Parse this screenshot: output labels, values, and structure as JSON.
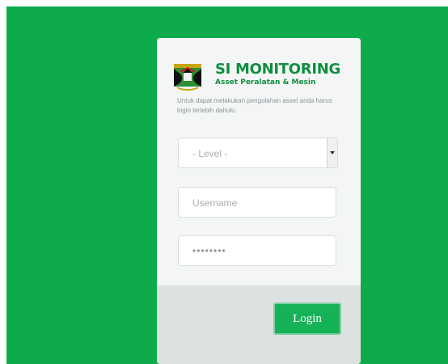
{
  "app": {
    "title": "SI MONITORING",
    "subtitle": "Asset Peralatan & Mesin",
    "intro_text": "Untuk dapat melakukan pengolahan asset anda harus login terlebih dahulu."
  },
  "form": {
    "level_select": {
      "selected_value": "- Level -",
      "options": [
        "- Level -"
      ]
    },
    "username": {
      "value": "",
      "placeholder": "Username"
    },
    "password": {
      "value": "••••••••",
      "placeholder": ""
    },
    "login_label": "Login"
  },
  "colors": {
    "background": "#0eab4c",
    "brand": "#0f8f3f",
    "button": "#16b257",
    "card": "#f4f6f6",
    "card_footer": "#dce1e2"
  },
  "icons": {
    "logo": "minangkabau-crest-icon",
    "dropdown": "dropdown-arrow-icon"
  }
}
